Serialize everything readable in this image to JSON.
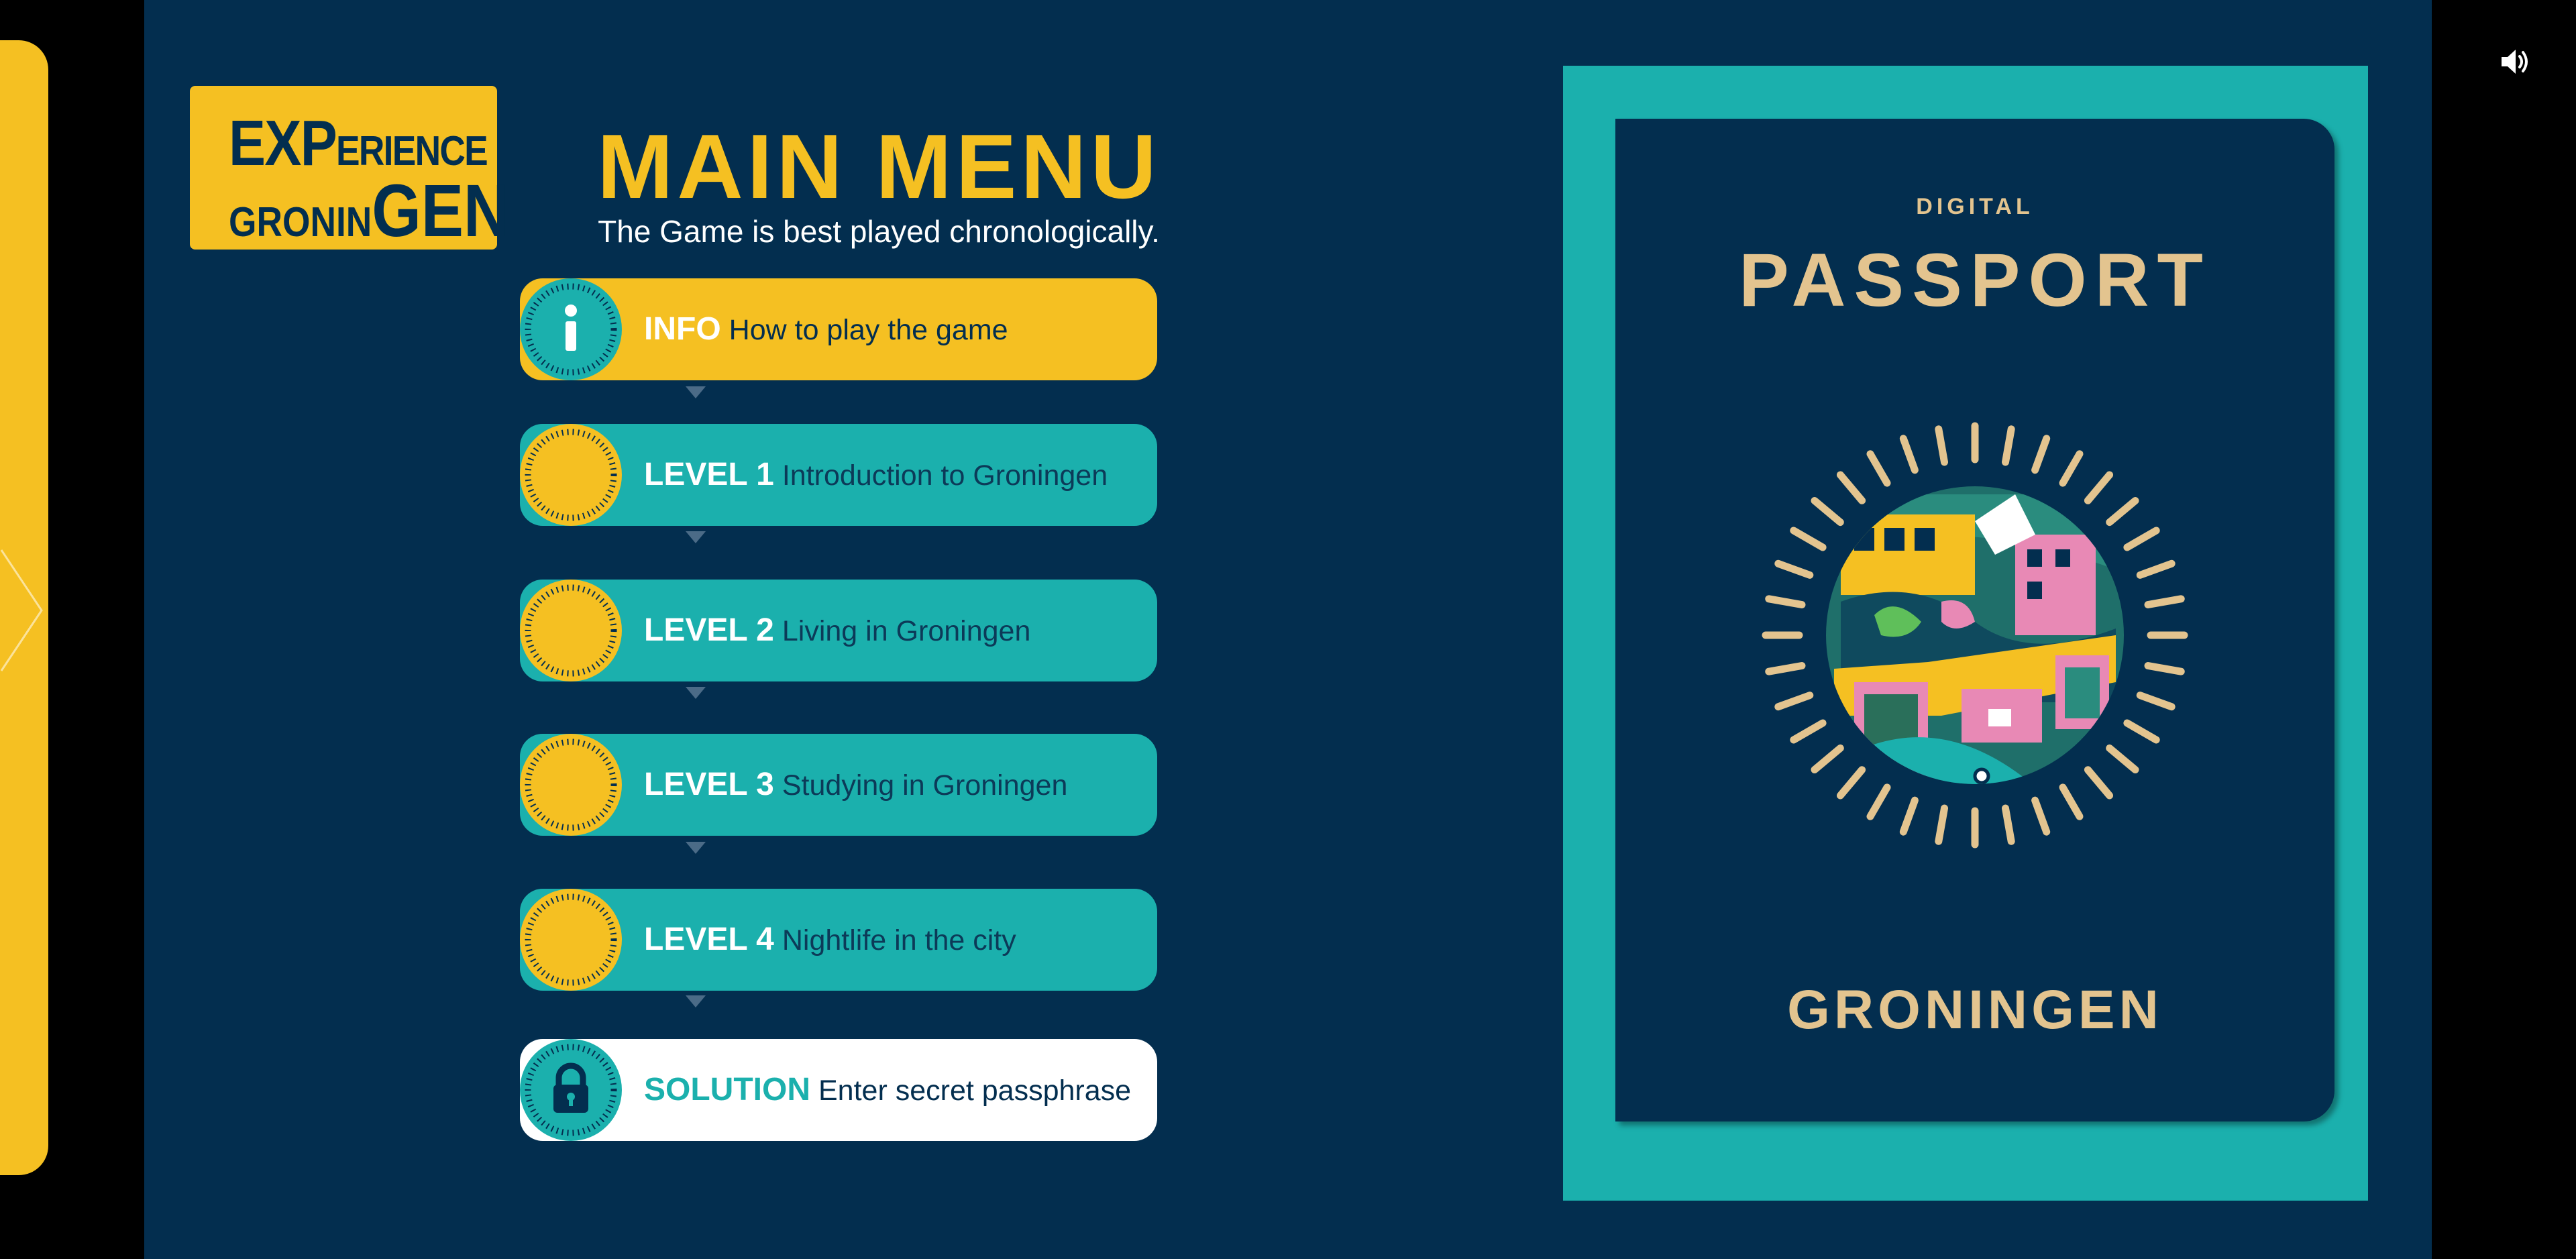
{
  "logo": {
    "line1_big": "EXP",
    "line1_small": "ERIENCE",
    "line2_small": "GRONIN",
    "line2_big": "GEN"
  },
  "header": {
    "title": "MAIN MENU",
    "subtitle": "The Game is best played chronologically."
  },
  "menu": {
    "items": [
      {
        "key": "INFO",
        "desc": "How to play the game",
        "style": "yellow",
        "icon": "info-icon"
      },
      {
        "key": "LEVEL 1",
        "desc": "Introduction to Groningen",
        "style": "teal",
        "icon": "sun-badge-icon"
      },
      {
        "key": "LEVEL 2",
        "desc": "Living in Groningen",
        "style": "teal",
        "icon": "sun-badge-icon"
      },
      {
        "key": "LEVEL 3",
        "desc": "Studying in Groningen",
        "style": "teal",
        "icon": "sun-badge-icon"
      },
      {
        "key": "LEVEL 4",
        "desc": "Nightlife in the city",
        "style": "teal",
        "icon": "sun-badge-icon"
      },
      {
        "key": "SOLUTION",
        "desc": "Enter secret passphrase",
        "style": "white",
        "icon": "lock-icon"
      }
    ]
  },
  "passport": {
    "label": "DIGITAL",
    "title": "PASSPORT",
    "city": "GRONINGEN"
  },
  "colors": {
    "navy": "#032e4f",
    "yellow": "#f5c022",
    "teal": "#1bb0ad",
    "tan": "#e3c48f"
  },
  "controls": {
    "audio_icon": "speaker-icon"
  }
}
